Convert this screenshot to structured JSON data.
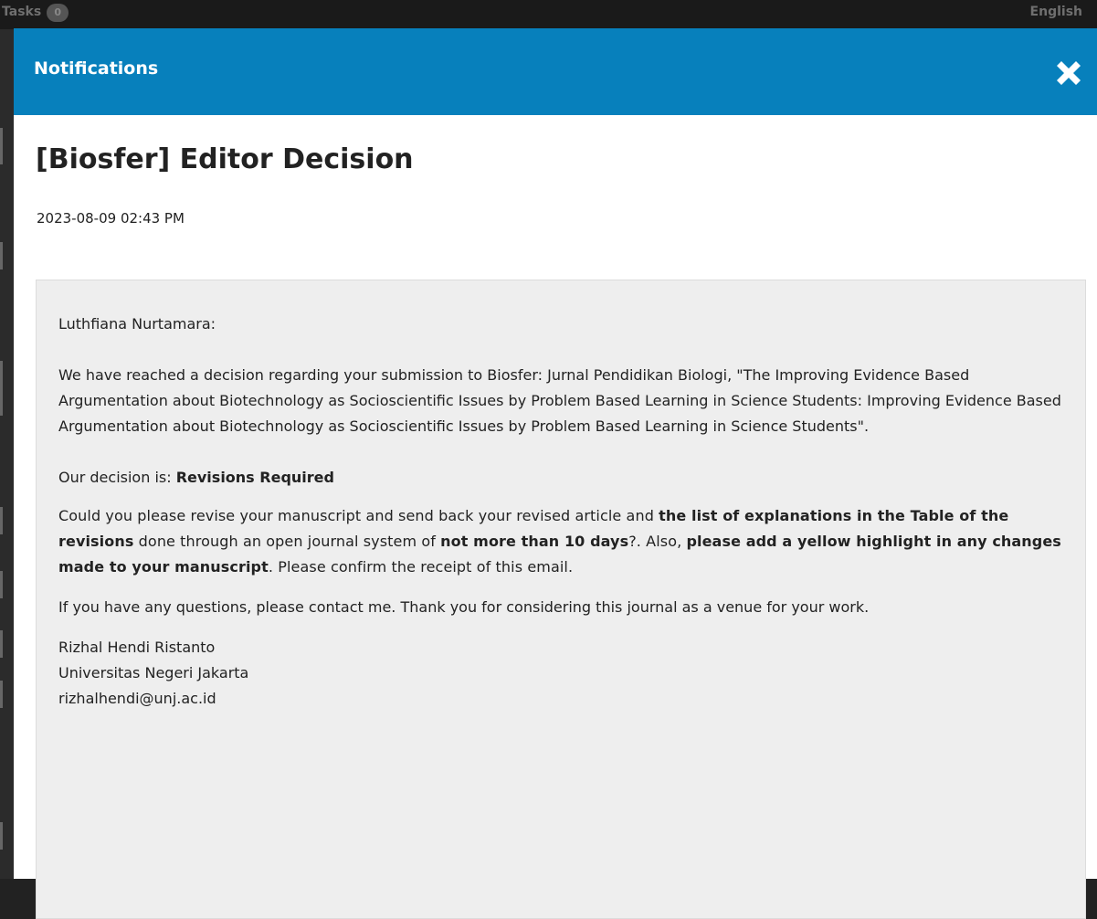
{
  "background": {
    "tasks_label": "Tasks",
    "tasks_count": "0",
    "language_label": "English"
  },
  "modal": {
    "title": "Notifications"
  },
  "notification": {
    "subject": "[Biosfer] Editor Decision",
    "date": "2023-08-09 02:43 PM",
    "greeting": "Luthfiana Nurtamara:",
    "para1": "We have reached a decision regarding your submission to Biosfer: Jurnal Pendidikan Biologi, \"The Improving Evidence Based Argumentation about Biotechnology as Socioscientific Issues by Problem Based Learning in Science Students: Improving Evidence Based Argumentation about Biotechnology as Socioscientific Issues by Problem Based Learning in Science Students\".",
    "decision_prefix": "Our decision is: ",
    "decision_value": "Revisions Required",
    "para3": {
      "t1": "Could you please revise your manuscript and send back your revised article and ",
      "b1": "the list of explanations in the Table of the revisions",
      "t2": " done through an open journal system of ",
      "b2": "not more than 10 days",
      "t3": "?. Also, ",
      "b3": "please add a yellow highlight in any changes made to your manuscript",
      "t4": ". Please confirm the receipt of this email."
    },
    "para4": "If you have any questions, please contact me. Thank you for considering this journal as a venue for your work.",
    "signature": {
      "name": "Rizhal Hendi Ristanto",
      "affiliation": "Universitas Negeri Jakarta",
      "email": "rizhalhendi@unj.ac.id"
    }
  },
  "colors": {
    "header": "#0780bc",
    "message_background": "#eeeeee"
  },
  "icons": {
    "close": "close-icon"
  }
}
